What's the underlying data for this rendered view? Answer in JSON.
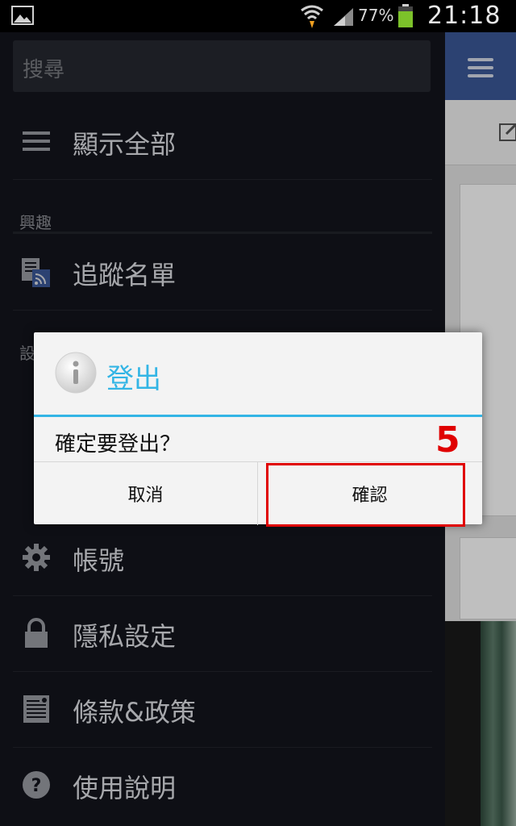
{
  "status_bar": {
    "battery_percent": "77%",
    "time": "21:18",
    "icons": [
      "gallery-icon",
      "wifi-icon",
      "signal-icon",
      "battery-icon"
    ]
  },
  "drawer": {
    "search_placeholder": "搜尋",
    "show_all": "顯示全部",
    "sections": {
      "interests": "興趣",
      "settings_partial": "設"
    },
    "items": [
      {
        "label": "追蹤名單",
        "icon": "following-list-icon"
      },
      {
        "label": "帳號",
        "icon": "gear-icon"
      },
      {
        "label": "隱私設定",
        "icon": "lock-icon"
      },
      {
        "label": "條款&政策",
        "icon": "document-icon"
      },
      {
        "label": "使用說明",
        "icon": "help-icon"
      }
    ]
  },
  "dialog": {
    "title": "登出",
    "message": "確定要登出？",
    "cancel_label": "取消",
    "confirm_label": "確認",
    "step_annotation": "5",
    "accent_color": "#33b5e5",
    "annotation_color": "#e00000"
  }
}
